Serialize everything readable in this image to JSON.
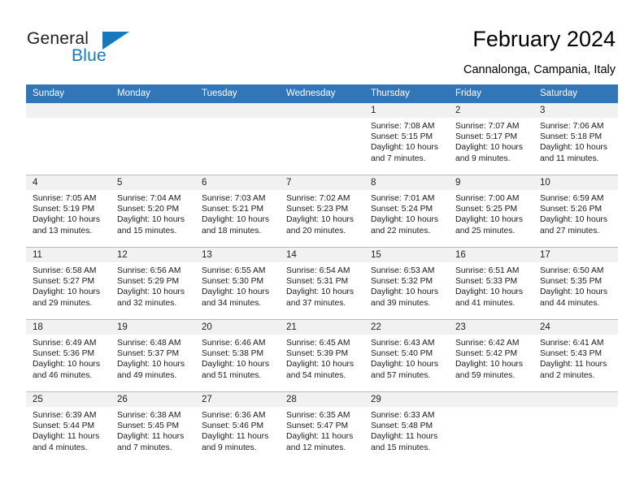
{
  "brand": {
    "name_part1": "General",
    "name_part2": "Blue"
  },
  "header": {
    "title": "February 2024",
    "location": "Cannalonga, Campania, Italy"
  },
  "colors": {
    "header_blue": "#3276b8",
    "brand_blue": "#1878be",
    "daynum_band": "#f1f1f1",
    "row_divider": "#b9b9b9"
  },
  "weekdays": [
    "Sunday",
    "Monday",
    "Tuesday",
    "Wednesday",
    "Thursday",
    "Friday",
    "Saturday"
  ],
  "weeks": [
    [
      {
        "blank": true,
        "day": ""
      },
      {
        "blank": true,
        "day": ""
      },
      {
        "blank": true,
        "day": ""
      },
      {
        "blank": true,
        "day": ""
      },
      {
        "day": "1",
        "sunrise": "Sunrise: 7:08 AM",
        "sunset": "Sunset: 5:15 PM",
        "daylight1": "Daylight: 10 hours",
        "daylight2": "and 7 minutes."
      },
      {
        "day": "2",
        "sunrise": "Sunrise: 7:07 AM",
        "sunset": "Sunset: 5:17 PM",
        "daylight1": "Daylight: 10 hours",
        "daylight2": "and 9 minutes."
      },
      {
        "day": "3",
        "sunrise": "Sunrise: 7:06 AM",
        "sunset": "Sunset: 5:18 PM",
        "daylight1": "Daylight: 10 hours",
        "daylight2": "and 11 minutes."
      }
    ],
    [
      {
        "day": "4",
        "sunrise": "Sunrise: 7:05 AM",
        "sunset": "Sunset: 5:19 PM",
        "daylight1": "Daylight: 10 hours",
        "daylight2": "and 13 minutes."
      },
      {
        "day": "5",
        "sunrise": "Sunrise: 7:04 AM",
        "sunset": "Sunset: 5:20 PM",
        "daylight1": "Daylight: 10 hours",
        "daylight2": "and 15 minutes."
      },
      {
        "day": "6",
        "sunrise": "Sunrise: 7:03 AM",
        "sunset": "Sunset: 5:21 PM",
        "daylight1": "Daylight: 10 hours",
        "daylight2": "and 18 minutes."
      },
      {
        "day": "7",
        "sunrise": "Sunrise: 7:02 AM",
        "sunset": "Sunset: 5:23 PM",
        "daylight1": "Daylight: 10 hours",
        "daylight2": "and 20 minutes."
      },
      {
        "day": "8",
        "sunrise": "Sunrise: 7:01 AM",
        "sunset": "Sunset: 5:24 PM",
        "daylight1": "Daylight: 10 hours",
        "daylight2": "and 22 minutes."
      },
      {
        "day": "9",
        "sunrise": "Sunrise: 7:00 AM",
        "sunset": "Sunset: 5:25 PM",
        "daylight1": "Daylight: 10 hours",
        "daylight2": "and 25 minutes."
      },
      {
        "day": "10",
        "sunrise": "Sunrise: 6:59 AM",
        "sunset": "Sunset: 5:26 PM",
        "daylight1": "Daylight: 10 hours",
        "daylight2": "and 27 minutes."
      }
    ],
    [
      {
        "day": "11",
        "sunrise": "Sunrise: 6:58 AM",
        "sunset": "Sunset: 5:27 PM",
        "daylight1": "Daylight: 10 hours",
        "daylight2": "and 29 minutes."
      },
      {
        "day": "12",
        "sunrise": "Sunrise: 6:56 AM",
        "sunset": "Sunset: 5:29 PM",
        "daylight1": "Daylight: 10 hours",
        "daylight2": "and 32 minutes."
      },
      {
        "day": "13",
        "sunrise": "Sunrise: 6:55 AM",
        "sunset": "Sunset: 5:30 PM",
        "daylight1": "Daylight: 10 hours",
        "daylight2": "and 34 minutes."
      },
      {
        "day": "14",
        "sunrise": "Sunrise: 6:54 AM",
        "sunset": "Sunset: 5:31 PM",
        "daylight1": "Daylight: 10 hours",
        "daylight2": "and 37 minutes."
      },
      {
        "day": "15",
        "sunrise": "Sunrise: 6:53 AM",
        "sunset": "Sunset: 5:32 PM",
        "daylight1": "Daylight: 10 hours",
        "daylight2": "and 39 minutes."
      },
      {
        "day": "16",
        "sunrise": "Sunrise: 6:51 AM",
        "sunset": "Sunset: 5:33 PM",
        "daylight1": "Daylight: 10 hours",
        "daylight2": "and 41 minutes."
      },
      {
        "day": "17",
        "sunrise": "Sunrise: 6:50 AM",
        "sunset": "Sunset: 5:35 PM",
        "daylight1": "Daylight: 10 hours",
        "daylight2": "and 44 minutes."
      }
    ],
    [
      {
        "day": "18",
        "sunrise": "Sunrise: 6:49 AM",
        "sunset": "Sunset: 5:36 PM",
        "daylight1": "Daylight: 10 hours",
        "daylight2": "and 46 minutes."
      },
      {
        "day": "19",
        "sunrise": "Sunrise: 6:48 AM",
        "sunset": "Sunset: 5:37 PM",
        "daylight1": "Daylight: 10 hours",
        "daylight2": "and 49 minutes."
      },
      {
        "day": "20",
        "sunrise": "Sunrise: 6:46 AM",
        "sunset": "Sunset: 5:38 PM",
        "daylight1": "Daylight: 10 hours",
        "daylight2": "and 51 minutes."
      },
      {
        "day": "21",
        "sunrise": "Sunrise: 6:45 AM",
        "sunset": "Sunset: 5:39 PM",
        "daylight1": "Daylight: 10 hours",
        "daylight2": "and 54 minutes."
      },
      {
        "day": "22",
        "sunrise": "Sunrise: 6:43 AM",
        "sunset": "Sunset: 5:40 PM",
        "daylight1": "Daylight: 10 hours",
        "daylight2": "and 57 minutes."
      },
      {
        "day": "23",
        "sunrise": "Sunrise: 6:42 AM",
        "sunset": "Sunset: 5:42 PM",
        "daylight1": "Daylight: 10 hours",
        "daylight2": "and 59 minutes."
      },
      {
        "day": "24",
        "sunrise": "Sunrise: 6:41 AM",
        "sunset": "Sunset: 5:43 PM",
        "daylight1": "Daylight: 11 hours",
        "daylight2": "and 2 minutes."
      }
    ],
    [
      {
        "day": "25",
        "sunrise": "Sunrise: 6:39 AM",
        "sunset": "Sunset: 5:44 PM",
        "daylight1": "Daylight: 11 hours",
        "daylight2": "and 4 minutes."
      },
      {
        "day": "26",
        "sunrise": "Sunrise: 6:38 AM",
        "sunset": "Sunset: 5:45 PM",
        "daylight1": "Daylight: 11 hours",
        "daylight2": "and 7 minutes."
      },
      {
        "day": "27",
        "sunrise": "Sunrise: 6:36 AM",
        "sunset": "Sunset: 5:46 PM",
        "daylight1": "Daylight: 11 hours",
        "daylight2": "and 9 minutes."
      },
      {
        "day": "28",
        "sunrise": "Sunrise: 6:35 AM",
        "sunset": "Sunset: 5:47 PM",
        "daylight1": "Daylight: 11 hours",
        "daylight2": "and 12 minutes."
      },
      {
        "day": "29",
        "sunrise": "Sunrise: 6:33 AM",
        "sunset": "Sunset: 5:48 PM",
        "daylight1": "Daylight: 11 hours",
        "daylight2": "and 15 minutes."
      },
      {
        "blank": true,
        "day": ""
      },
      {
        "blank": true,
        "day": ""
      }
    ]
  ]
}
